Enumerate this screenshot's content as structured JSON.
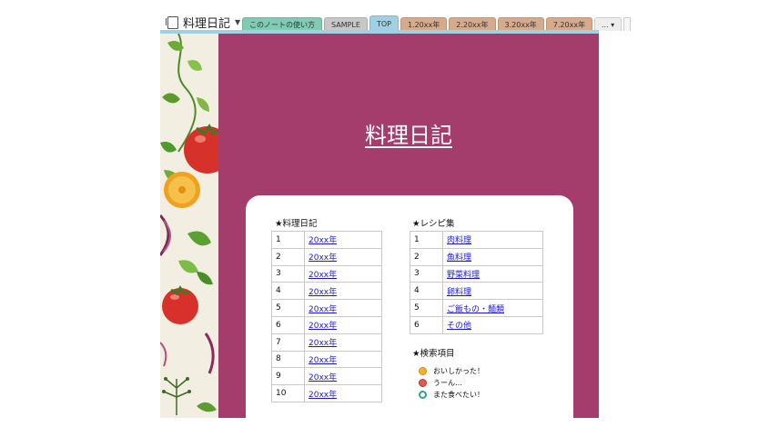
{
  "notebook": {
    "title": "料理日記"
  },
  "tabs": [
    {
      "label": "このノートの使い方",
      "color": "#7fcbb4",
      "active": false
    },
    {
      "label": "SAMPLE",
      "color": "#c7c7c7",
      "active": false
    },
    {
      "label": "TOP",
      "color": "#9fd0e3",
      "active": true
    },
    {
      "label": "1.20xx年",
      "color": "#d8aa8c",
      "active": false
    },
    {
      "label": "2.20xx年",
      "color": "#d8aa8c",
      "active": false
    },
    {
      "label": "3.20xx年",
      "color": "#d8aa8c",
      "active": false
    },
    {
      "label": "7.20xx年",
      "color": "#d8aa8c",
      "active": false
    }
  ],
  "more_tabs_label": "...",
  "page": {
    "title": "料理日記",
    "background_color": "#a53d6c"
  },
  "diary": {
    "heading": "★料理日記",
    "rows": [
      {
        "num": "1",
        "label": "20xx年"
      },
      {
        "num": "2",
        "label": "20xx年"
      },
      {
        "num": "3",
        "label": "20xx年"
      },
      {
        "num": "4",
        "label": "20xx年"
      },
      {
        "num": "5",
        "label": "20xx年"
      },
      {
        "num": "6",
        "label": "20xx年"
      },
      {
        "num": "7",
        "label": "20xx年"
      },
      {
        "num": "8",
        "label": "20xx年"
      },
      {
        "num": "9",
        "label": "20xx年"
      },
      {
        "num": "10",
        "label": "20xx年"
      }
    ]
  },
  "recipes": {
    "heading": "★レシピ集",
    "rows": [
      {
        "num": "1",
        "label": "肉料理"
      },
      {
        "num": "2",
        "label": "魚料理"
      },
      {
        "num": "3",
        "label": "野菜料理"
      },
      {
        "num": "4",
        "label": "卵料理"
      },
      {
        "num": "5",
        "label": "ご飯もの・麺類"
      },
      {
        "num": "6",
        "label": "その他"
      }
    ]
  },
  "search": {
    "heading": "★検索項目",
    "items": [
      {
        "icon": "smile-face-icon",
        "label": "おいしかった！"
      },
      {
        "icon": "frown-face-icon",
        "label": "うーん…"
      },
      {
        "icon": "again-circle-icon",
        "label": "また食べたい！"
      }
    ]
  }
}
